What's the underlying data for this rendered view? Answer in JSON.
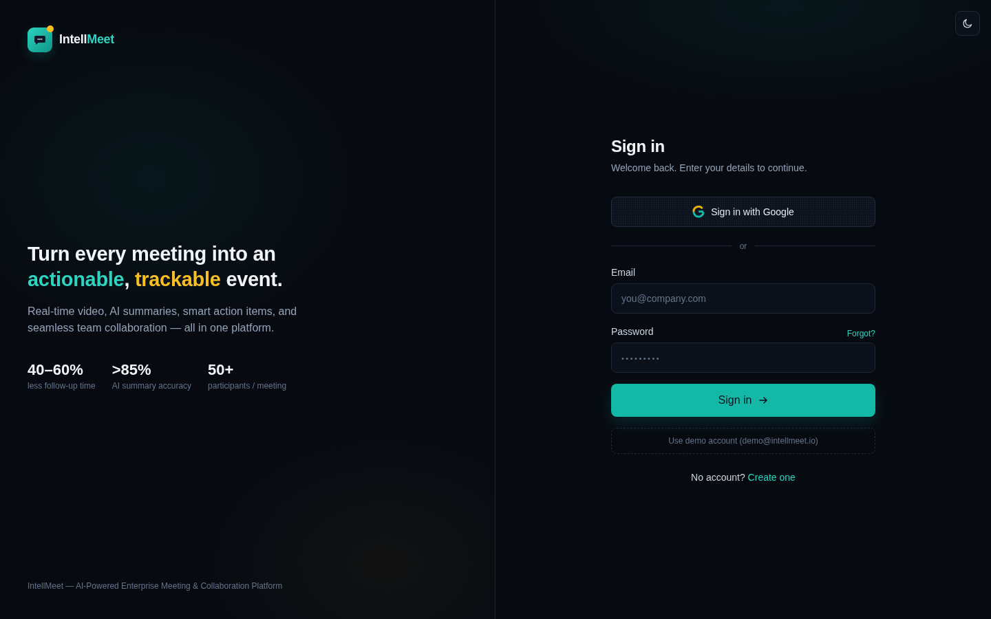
{
  "brand": {
    "parts": [
      {
        "text": "Intell",
        "color": "#f1f5f9"
      },
      {
        "text": "Meet",
        "color": "#2dd4bf"
      }
    ]
  },
  "hero": {
    "headline": [
      {
        "text": "Turn every meeting into an ",
        "color": "#f1f5f9"
      },
      {
        "text": "actionable",
        "color": "#2dd4bf"
      },
      {
        "text": ", ",
        "color": "#f1f5f9"
      },
      {
        "text": "trackable",
        "color": "#fbbf24"
      },
      {
        "text": " event.",
        "color": "#f1f5f9"
      }
    ],
    "description": "Real-time video, AI summaries, smart action items, and seamless team collaboration — all in one platform.",
    "stats": [
      {
        "value": "40–60%",
        "label": "less follow-up time"
      },
      {
        "value": ">85%",
        "label": "AI summary accuracy"
      },
      {
        "value": "50+",
        "label": "participants / meeting"
      }
    ]
  },
  "footer": "IntellMeet — AI-Powered Enterprise Meeting & Collaboration Platform",
  "signin": {
    "title": "Sign in",
    "subtitle": "Welcome back. Enter your details to continue.",
    "google_button": "Sign in with Google",
    "divider": "or",
    "fields": [
      {
        "kind": "email",
        "label": "Email",
        "placeholder": "you@company.com"
      },
      {
        "kind": "password",
        "label": "Password",
        "link": "Forgot?",
        "placeholder": "•••••••••"
      }
    ],
    "submit_button": "Sign in",
    "demo_button": "Use demo account (demo@intellmeet.io)",
    "prompt": {
      "text": "No account?",
      "link": "Create one"
    }
  }
}
